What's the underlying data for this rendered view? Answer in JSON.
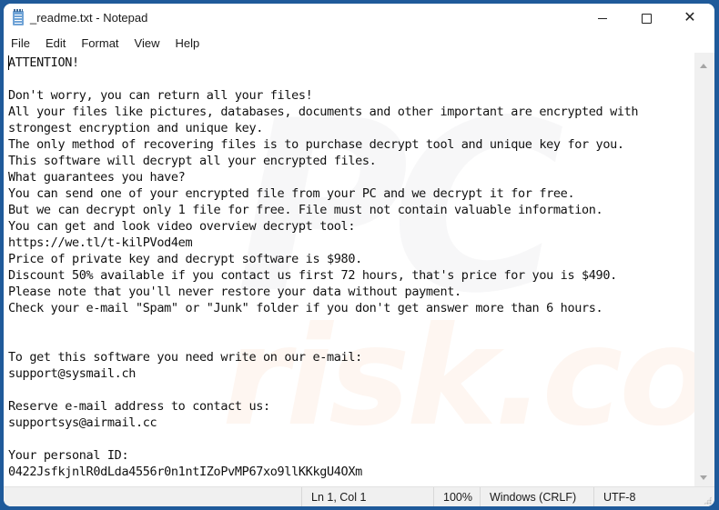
{
  "window": {
    "title": "_readme.txt - Notepad",
    "app_icon": "notepad-icon",
    "controls": {
      "minimize": "minimize-icon",
      "maximize": "maximize-icon",
      "close": "close-icon",
      "close_glyph": "✕"
    }
  },
  "menu": {
    "items": [
      "File",
      "Edit",
      "Format",
      "View",
      "Help"
    ]
  },
  "editor": {
    "lines": [
      "ATTENTION!",
      "",
      "Don't worry, you can return all your files!",
      "All your files like pictures, databases, documents and other important are encrypted with",
      "strongest encryption and unique key.",
      "The only method of recovering files is to purchase decrypt tool and unique key for you.",
      "This software will decrypt all your encrypted files.",
      "What guarantees you have?",
      "You can send one of your encrypted file from your PC and we decrypt it for free.",
      "But we can decrypt only 1 file for free. File must not contain valuable information.",
      "You can get and look video overview decrypt tool:",
      "https://we.tl/t-kilPVod4em",
      "Price of private key and decrypt software is $980.",
      "Discount 50% available if you contact us first 72 hours, that's price for you is $490.",
      "Please note that you'll never restore your data without payment.",
      "Check your e-mail \"Spam\" or \"Junk\" folder if you don't get answer more than 6 hours.",
      "",
      "",
      "To get this software you need write on our e-mail:",
      "support@sysmail.ch",
      "",
      "Reserve e-mail address to contact us:",
      "supportsys@airmail.cc",
      "",
      "Your personal ID:",
      "0422JsfkjnlR0dLda4556r0n1ntIZoPvMP67xo9llKKkgU4OXm"
    ],
    "watermark": {
      "top": "PC",
      "bottom": "risk.com"
    }
  },
  "statusbar": {
    "position": "Ln 1, Col 1",
    "zoom": "100%",
    "line_ending": "Windows (CRLF)",
    "encoding": "UTF-8"
  }
}
